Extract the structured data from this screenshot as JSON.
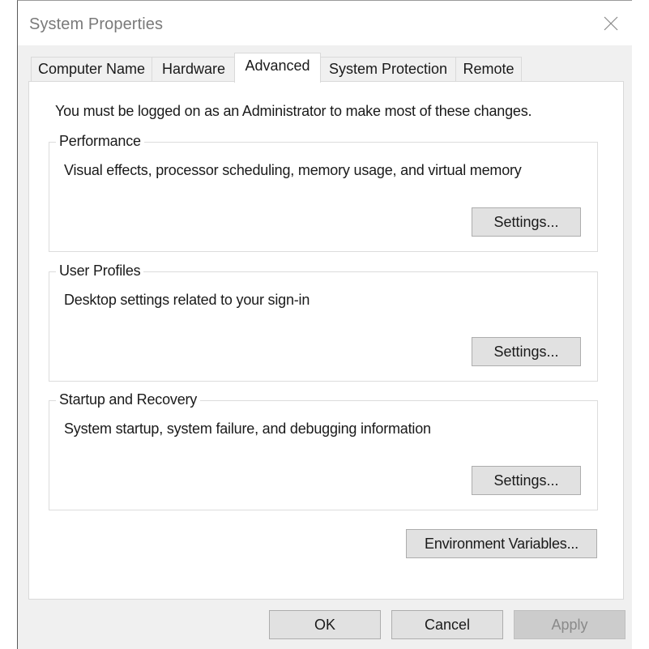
{
  "window": {
    "title": "System Properties",
    "close_icon": "close-x-icon"
  },
  "tabs": [
    {
      "label": "Computer Name",
      "active": false
    },
    {
      "label": "Hardware",
      "active": false
    },
    {
      "label": "Advanced",
      "active": true
    },
    {
      "label": "System Protection",
      "active": false
    },
    {
      "label": "Remote",
      "active": false
    }
  ],
  "advanced": {
    "admin_note": "You must be logged on as an Administrator to make most of these changes.",
    "groups": [
      {
        "title": "Performance",
        "description": "Visual effects, processor scheduling, memory usage, and virtual memory",
        "button_label": "Settings..."
      },
      {
        "title": "User Profiles",
        "description": "Desktop settings related to your sign-in",
        "button_label": "Settings..."
      },
      {
        "title": "Startup and Recovery",
        "description": "System startup, system failure, and debugging information",
        "button_label": "Settings..."
      }
    ],
    "environment_variables_label": "Environment Variables..."
  },
  "footer": {
    "ok_label": "OK",
    "cancel_label": "Cancel",
    "apply_label": "Apply",
    "apply_enabled": false
  },
  "colors": {
    "window_bg": "#f0f0f0",
    "panel_bg": "#ffffff",
    "button_bg": "#e1e1e1",
    "button_border": "#adadad",
    "disabled_button_bg": "#cccccc",
    "disabled_text": "#8a8a8a",
    "title_text": "#7a7a7a"
  }
}
